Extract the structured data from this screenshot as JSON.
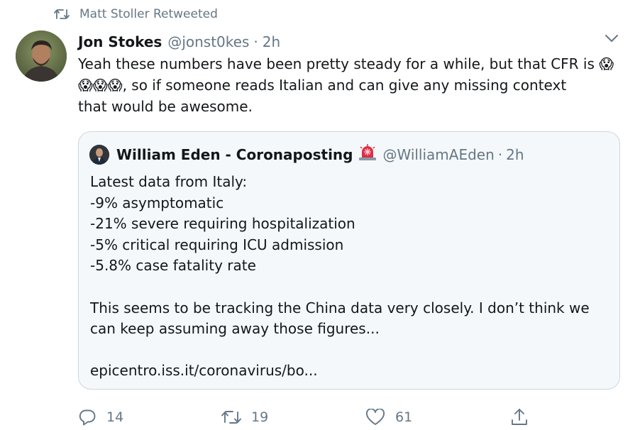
{
  "retweet_context": {
    "icon": "retweet-icon",
    "text": "Matt Stoller Retweeted"
  },
  "tweet": {
    "author_name": "Jon Stokes",
    "handle": "@jonst0kes",
    "separator": "·",
    "time": "2h",
    "text_parts": {
      "line1": "Yeah these numbers have been pretty steady for a while, but that CFR is ",
      "emoji": "😱",
      "line2_rest": ", so if someone reads Italian and can give any missing context",
      "line3": "that would be awesome."
    }
  },
  "quote": {
    "author_name": "William Eden - Coronaposting",
    "siren_emoji": "🚨",
    "handle": "@WilliamAEden",
    "separator": "·",
    "time": "2h",
    "lines": [
      "Latest data from Italy:",
      "-9% asymptomatic",
      "-21% severe requiring hospitalization",
      "-5% critical requiring ICU admission",
      "-5.8% case fatality rate"
    ],
    "paragraph": [
      "This seems to be tracking the China data very closely. I don’t think we",
      "can keep assuming away those figures..."
    ],
    "link": "epicentro.iss.it/coronavirus/bo..."
  },
  "actions": {
    "reply_count": "14",
    "retweet_count": "19",
    "like_count": "61"
  },
  "colors": {
    "text": "#14171a",
    "secondary": "#657786",
    "quote_bg": "#f5f8fa",
    "quote_border": "#ccd6dd"
  }
}
